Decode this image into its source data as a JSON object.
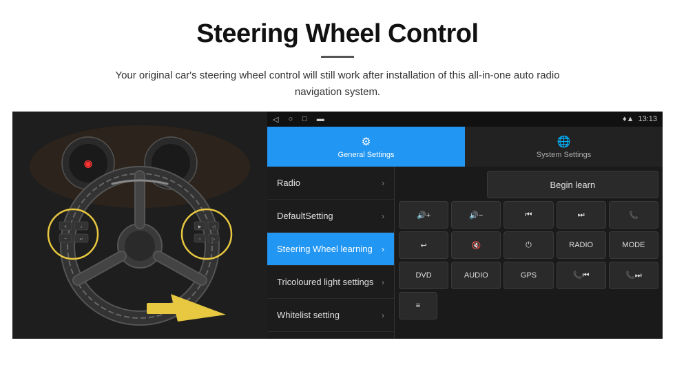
{
  "header": {
    "title": "Steering Wheel Control",
    "subtitle": "Your original car's steering wheel control will still work after installation of this all-in-one auto radio navigation system."
  },
  "status_bar": {
    "time": "13:13",
    "nav_icons": [
      "◁",
      "○",
      "□",
      "▬"
    ],
    "signal_icons": [
      "♦",
      "▲"
    ]
  },
  "tabs": [
    {
      "label": "General Settings",
      "icon": "⚙",
      "active": true
    },
    {
      "label": "System Settings",
      "icon": "🌐",
      "active": false
    }
  ],
  "menu_items": [
    {
      "label": "Radio",
      "active": false
    },
    {
      "label": "DefaultSetting",
      "active": false
    },
    {
      "label": "Steering Wheel learning",
      "active": true
    },
    {
      "label": "Tricoloured light settings",
      "active": false
    },
    {
      "label": "Whitelist setting",
      "active": false
    }
  ],
  "controls": {
    "begin_learn_label": "Begin learn",
    "row2": [
      "🔊+",
      "🔊−",
      "⏮",
      "⏭",
      "📞"
    ],
    "row3": [
      "↩",
      "🔊×",
      "⏻",
      "RADIO",
      "MODE"
    ],
    "row4": [
      "DVD",
      "AUDIO",
      "GPS",
      "📞⏮",
      "📞⏭"
    ],
    "row5": [
      "≡"
    ]
  }
}
